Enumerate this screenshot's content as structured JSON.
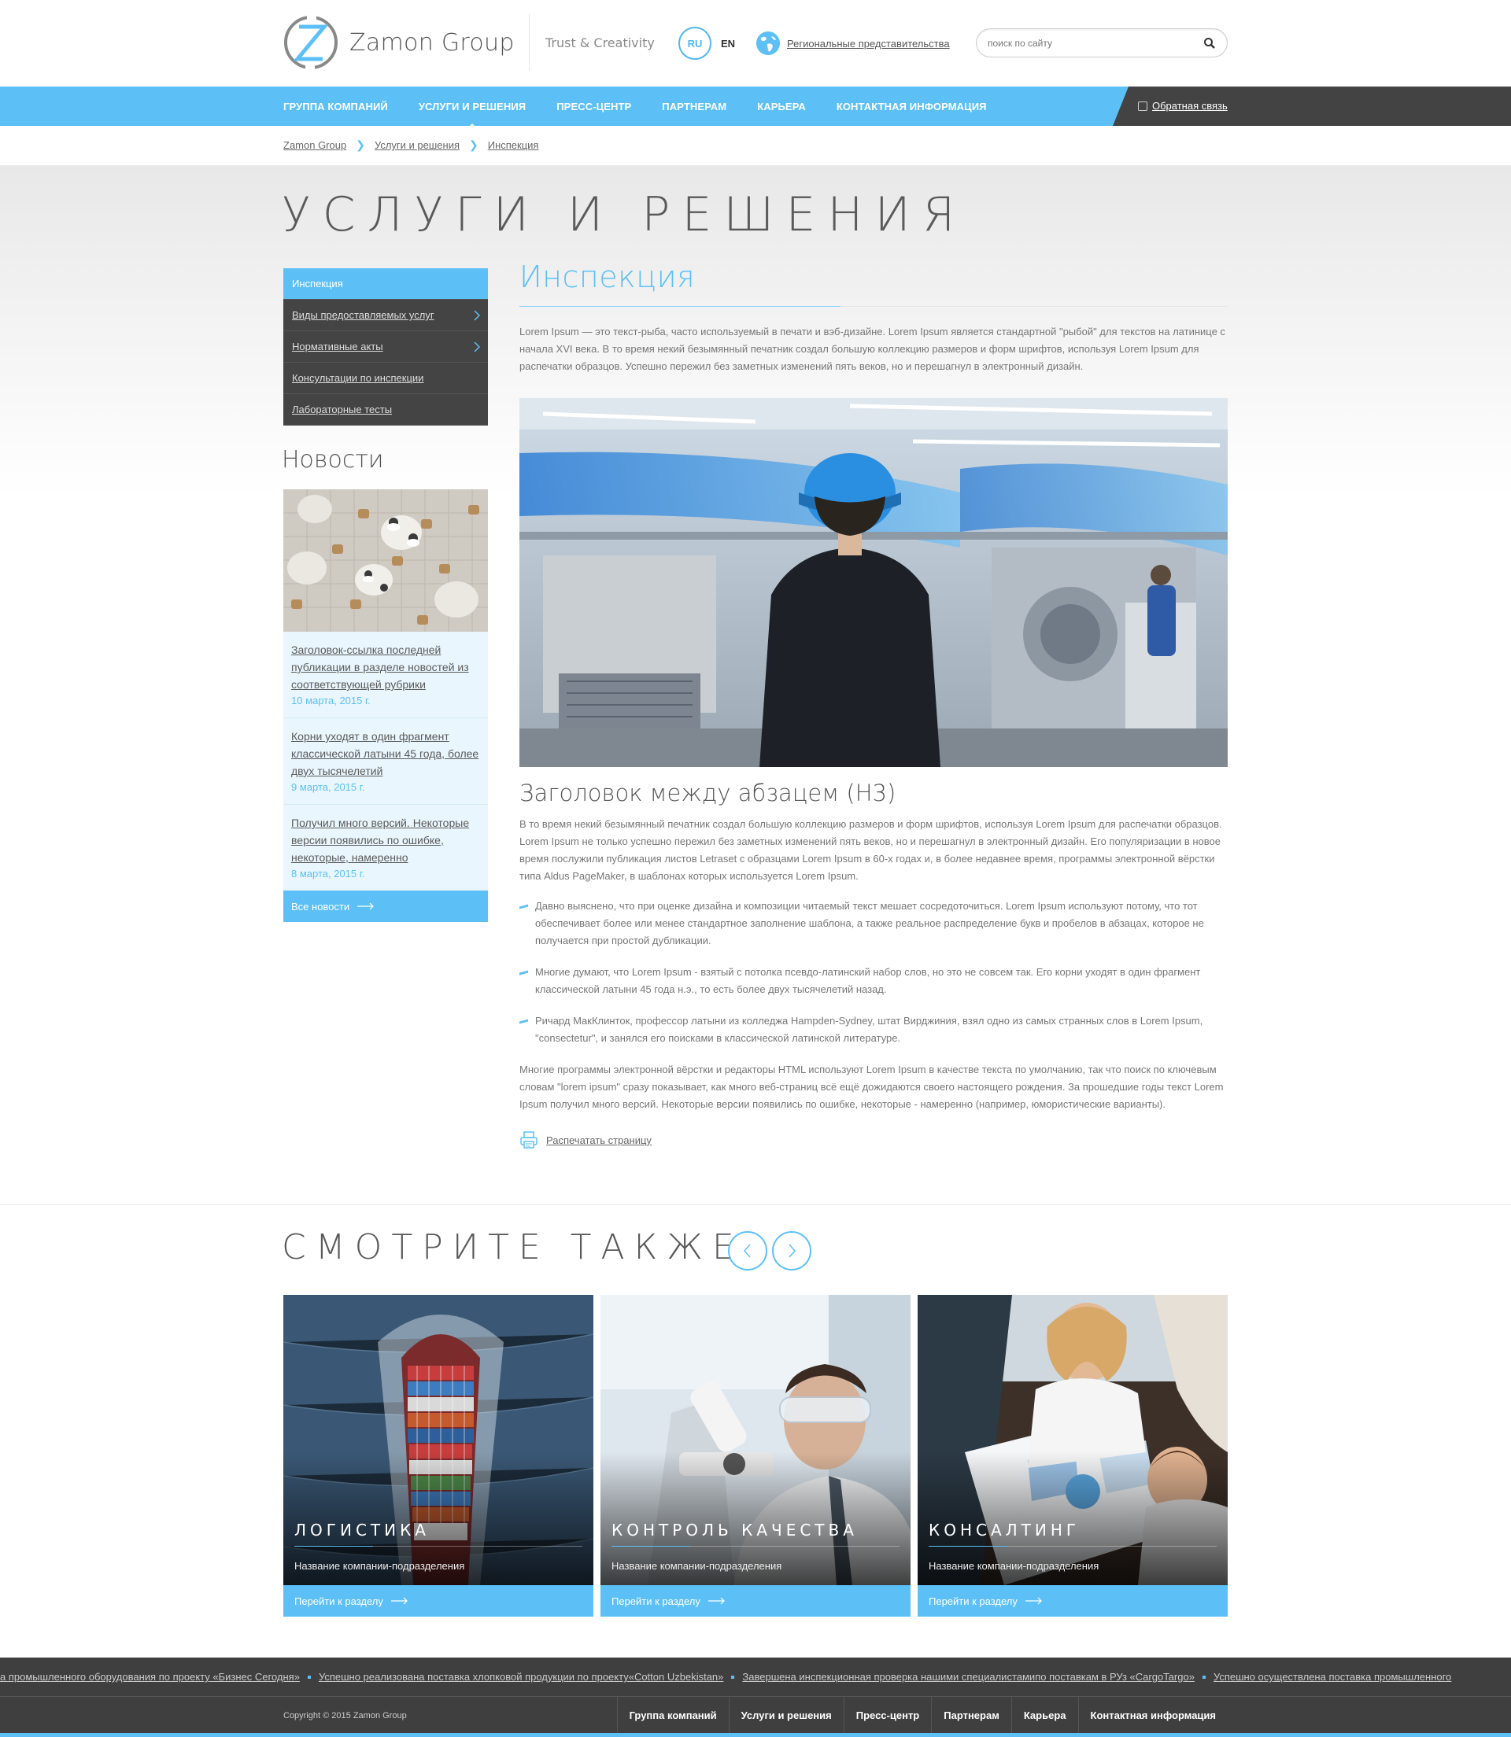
{
  "header": {
    "logo_text": "Zamon Group",
    "tagline": "Trust & Creativity",
    "lang_active": "RU",
    "lang_other": "EN",
    "regions_link": "Региональные представительства",
    "search_placeholder": "поиск по сайту"
  },
  "nav": {
    "items": [
      {
        "label": "ГРУППА КОМПАНИЙ"
      },
      {
        "label": "УСЛУГИ И РЕШЕНИЯ"
      },
      {
        "label": "ПРЕСС-ЦЕНТР"
      },
      {
        "label": "ПАРТНЕРАМ"
      },
      {
        "label": "КАРЬЕРА"
      },
      {
        "label": "КОНТАКТНАЯ ИНФОРМАЦИЯ"
      }
    ],
    "active_index": 1,
    "feedback": "Обратная связь"
  },
  "breadcrumb": [
    "Zamon Group",
    "Услуги и решения",
    "Инспекция"
  ],
  "page_title": "УСЛУГИ И РЕШЕНИЯ",
  "sidebar": {
    "items": [
      {
        "label": "Инспекция"
      },
      {
        "label": "Виды предоставляемых услуг"
      },
      {
        "label": "Нормативные акты"
      },
      {
        "label": "Консультации по инспекции"
      },
      {
        "label": "Лабораторные тесты"
      }
    ]
  },
  "news": {
    "title": "Новости",
    "items": [
      {
        "title": "Заголовок-ссылка последней публикации в разделе новостей из соответствующей рубрики",
        "date": "10 марта, 2015 г."
      },
      {
        "title": "Корни уходят в один фрагмент классической латыни 45 года, более двух тысячелетий",
        "date": "9 марта, 2015 г."
      },
      {
        "title": "Получил много версий. Некоторые версии появились по ошибке, некоторые, намеренно",
        "date": "8 марта, 2015 г."
      }
    ],
    "all_label": "Все новости"
  },
  "article": {
    "title": "Инспекция",
    "intro": "Lorem Ipsum — это текст-рыба, часто используемый в печати и вэб-дизайне. Lorem Ipsum является стандартной \"рыбой\" для текстов на латинице с начала XVI века. В то время некий безымянный печатник создал большую коллекцию размеров и форм шрифтов, используя Lorem Ipsum для распечатки образцов. Успешно пережил без заметных изменений пять веков, но и перешагнул в электронный дизайн.",
    "h3": "Заголовок между абзацем (H3)",
    "para2": "В то время некий безымянный печатник создал большую коллекцию размеров и форм шрифтов, используя Lorem Ipsum для распечатки образцов. Lorem Ipsum не только успешно пережил без заметных изменений пять веков, но и перешагнул в электронный дизайн. Его популяризации в новое время послужили публикация листов Letraset с образцами Lorem Ipsum в 60-х годах и, в более недавнее время, программы электронной вёрстки типа Aldus PageMaker, в шаблонах которых используется Lorem Ipsum.",
    "bullets": [
      "Давно выяснено, что при оценке дизайна и композиции читаемый текст мешает сосредоточиться. Lorem Ipsum используют потому, что тот обеспечивает более или менее стандартное заполнение шаблона, а также реальное распределение букв и пробелов в абзацах, которое не получается при простой дубликации.",
      "Многие думают, что Lorem Ipsum - взятый с потолка псевдо-латинский набор слов, но это не совсем так. Его корни уходят в один фрагмент классической латыни 45 года н.э., то есть более двух тысячелетий назад.",
      "Ричард МакКлинток, профессор латыни из колледжа Hampden-Sydney, штат Вирджиния, взял одно из самых странных слов в Lorem Ipsum, \"consectetur\", и занялся его поисками в классической латинской литературе."
    ],
    "para3": "Многие программы электронной вёрстки и редакторы HTML используют Lorem Ipsum в качестве текста по умолчанию, так что поиск по ключевым словам \"lorem ipsum\" сразу показывает, как много веб-страниц всё ещё дожидаются своего настоящего рождения. За прошедшие годы текст Lorem Ipsum получил много версий. Некоторые версии появились по ошибке, некоторые - намеренно (например, юмористические варианты).",
    "print_label": "Распечатать страницу"
  },
  "see_also": {
    "title": "СМОТРИТЕ ТАКЖЕ",
    "cards": [
      {
        "title": "ЛОГИСТИКА",
        "subtitle": "Название компании-подразделения",
        "link": "Перейти к разделу"
      },
      {
        "title": "КОНТРОЛЬ КАЧЕСТВА",
        "subtitle": "Название компании-подразделения",
        "link": "Перейти к разделу"
      },
      {
        "title": "КОНСАЛТИНГ",
        "subtitle": "Название компании-подразделения",
        "link": "Перейти к разделу"
      }
    ]
  },
  "ticker": [
    "а промышленного оборудования по проекту «Бизнес Сегодня»",
    "Успешно реализована поставка хлопковой продукции по проекту«Cotton Uzbekistan»",
    "Завершена инспекционная проверка нашими специалистамипо поставкам в РУз «CargoTargo»",
    "Успешно осуществлена поставка промышленного"
  ],
  "footer": {
    "copyright": "Copyright © 2015 Zamon Group",
    "links": [
      "Группа компаний",
      "Услуги и решения",
      "Пресс-центр",
      "Партнерам",
      "Карьера",
      "Контактная информация"
    ]
  },
  "colors": {
    "accent": "#5cc0f7",
    "dark": "#434343"
  }
}
